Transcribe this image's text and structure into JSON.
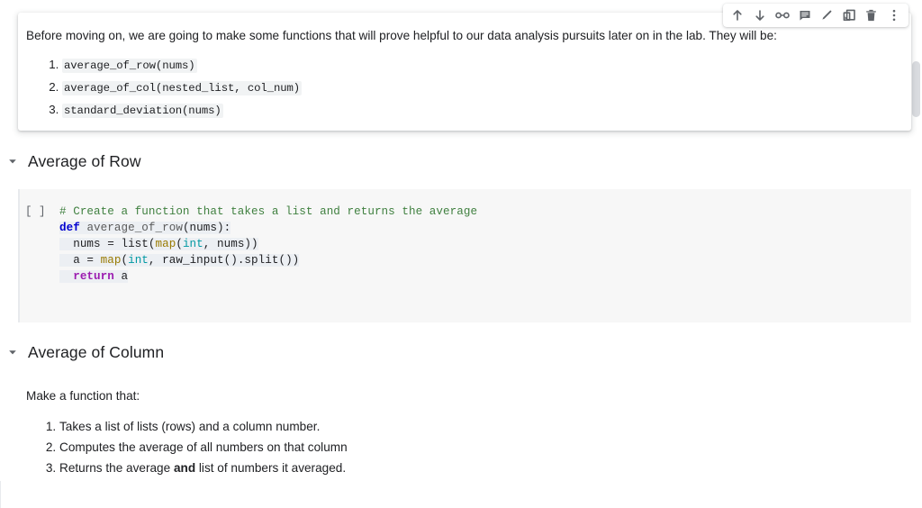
{
  "toolbar": {
    "buttons": [
      {
        "name": "move-cell-up-button",
        "icon": "arrow-up-icon",
        "label": "Move cell up"
      },
      {
        "name": "move-cell-down-button",
        "icon": "arrow-down-icon",
        "label": "Move cell down"
      },
      {
        "name": "link-to-cell-button",
        "icon": "link-icon",
        "label": "Link to cell"
      },
      {
        "name": "add-comment-button",
        "icon": "comment-icon",
        "label": "Add comment"
      },
      {
        "name": "edit-cell-button",
        "icon": "pencil-icon",
        "label": "Edit"
      },
      {
        "name": "mirror-cell-button",
        "icon": "mirror-cell-icon",
        "label": "Mirror cell in tab"
      },
      {
        "name": "delete-cell-button",
        "icon": "trash-icon",
        "label": "Delete cell"
      },
      {
        "name": "more-options-button",
        "icon": "more-vertical-icon",
        "label": "More cell actions"
      }
    ]
  },
  "text_cell": {
    "paragraph": "Before moving on, we are going to make some functions that will prove helpful to our data analysis pursuits later on in the lab. They will be:",
    "functions": [
      "average_of_row(nums)",
      "average_of_col(nested_list, col_num)",
      "standard_deviation(nums)"
    ]
  },
  "sections": [
    {
      "title": "Average of Row",
      "caret": "caret-down-icon"
    },
    {
      "title": "Average of Column",
      "caret": "caret-down-icon"
    }
  ],
  "code_cell": {
    "run_indicator": "[ ]",
    "lines": [
      {
        "highlight": false,
        "tokens": [
          {
            "text": "# Create a function that takes a list and returns the average",
            "cls": "tok-com"
          }
        ]
      },
      {
        "highlight": true,
        "tokens": [
          {
            "text": "def ",
            "cls": "tok-kw"
          },
          {
            "text": "average_of_row",
            "cls": "tok-fn"
          },
          {
            "text": "(nums):",
            "cls": "tok-plain"
          }
        ]
      },
      {
        "highlight": true,
        "tokens": [
          {
            "text": "  nums = list(",
            "cls": "tok-plain"
          },
          {
            "text": "map",
            "cls": "tok-bi"
          },
          {
            "text": "(",
            "cls": "tok-plain"
          },
          {
            "text": "int",
            "cls": "tok-type"
          },
          {
            "text": ", nums))",
            "cls": "tok-plain"
          }
        ]
      },
      {
        "highlight": true,
        "tokens": [
          {
            "text": "  a = ",
            "cls": "tok-plain"
          },
          {
            "text": "map",
            "cls": "tok-bi"
          },
          {
            "text": "(",
            "cls": "tok-plain"
          },
          {
            "text": "int",
            "cls": "tok-type"
          },
          {
            "text": ", raw_input().split())",
            "cls": "tok-plain"
          }
        ]
      },
      {
        "highlight": true,
        "tokens": [
          {
            "text": "  return",
            "cls": "tok-kw2"
          },
          {
            "text": " a",
            "cls": "tok-plain"
          }
        ]
      }
    ]
  },
  "markdown_block": {
    "intro": "Make a function that:",
    "steps": [
      {
        "before": "Takes a list of lists (rows) and a column number.",
        "bold": "",
        "after": ""
      },
      {
        "before": "Computes the average of all numbers on that column",
        "bold": "",
        "after": ""
      },
      {
        "before": "Returns the average ",
        "bold": "and",
        "after": " list of numbers it averaged."
      }
    ]
  },
  "colors": {
    "text": "#202124",
    "code_cell_bg": "#f7f7f7",
    "inline_code_bg": "#f1f3f4",
    "comment": "#408040",
    "keyword": "#0000cf",
    "keyword_control": "#9b1cb0",
    "builtin": "#997a00",
    "type": "#0099a3",
    "icon": "#5f6368",
    "scrollbar": "#dadce0"
  },
  "scrollbar": {
    "name": "vertical-scrollbar"
  }
}
